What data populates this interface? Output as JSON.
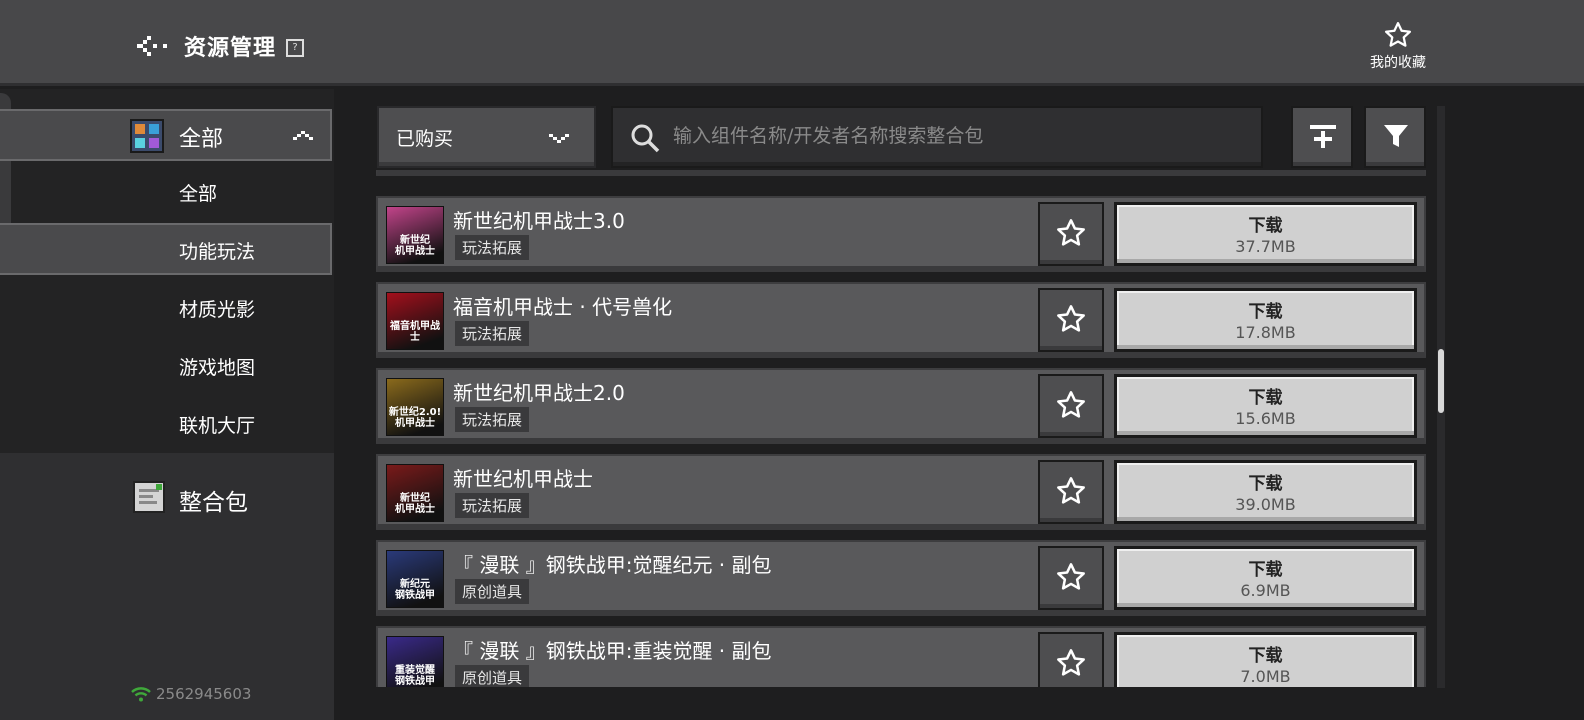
{
  "header": {
    "title": "资源管理",
    "help_icon": "question-mark-box-icon",
    "favorites_label": "我的收藏"
  },
  "sidebar": {
    "category": {
      "label": "全部",
      "expanded": true
    },
    "sub_items": [
      {
        "label": "全部",
        "selected": false
      },
      {
        "label": "功能玩法",
        "selected": true
      },
      {
        "label": "材质光影",
        "selected": false
      },
      {
        "label": "游戏地图",
        "selected": false
      },
      {
        "label": "联机大厅",
        "selected": false
      }
    ],
    "pack": {
      "label": "整合包"
    },
    "uid": "2562945603"
  },
  "toolbar": {
    "dropdown_value": "已购买",
    "search_placeholder": "输入组件名称/开发者名称搜索整合包"
  },
  "items": [
    {
      "title": "新世纪机甲战士3.0",
      "tag": "玩法拓展",
      "download_label": "下载",
      "size": "37.7MB",
      "thumb_text": "新世纪\n机甲战士",
      "thumb_color": "#c2448a"
    },
    {
      "title": "福音机甲战士 · 代号兽化",
      "tag": "玩法拓展",
      "download_label": "下载",
      "size": "17.8MB",
      "thumb_text": "福音机甲战士",
      "thumb_color": "#a3101c"
    },
    {
      "title": "新世纪机甲战士2.0",
      "tag": "玩法拓展",
      "download_label": "下载",
      "size": "15.6MB",
      "thumb_text": "新世纪2.0!\n机甲战士",
      "thumb_color": "#8a6a1c"
    },
    {
      "title": "新世纪机甲战士",
      "tag": "玩法拓展",
      "download_label": "下载",
      "size": "39.0MB",
      "thumb_text": "新世纪\n机甲战士",
      "thumb_color": "#7a1a1a"
    },
    {
      "title": "『 漫联 』钢铁战甲:觉醒纪元 · 副包",
      "tag": "原创道具",
      "download_label": "下载",
      "size": "6.9MB",
      "thumb_text": "新纪元\n钢铁战甲",
      "thumb_color": "#2a3a7a"
    },
    {
      "title": "『 漫联 』钢铁战甲:重装觉醒 · 副包",
      "tag": "原创道具",
      "download_label": "下载",
      "size": "7.0MB",
      "thumb_text": "重装觉醒\n钢铁战甲",
      "thumb_color": "#3a2a8a"
    }
  ],
  "colors": {
    "accent_wifi": "#3fa83a",
    "download_bg": "#d0d0d0"
  }
}
